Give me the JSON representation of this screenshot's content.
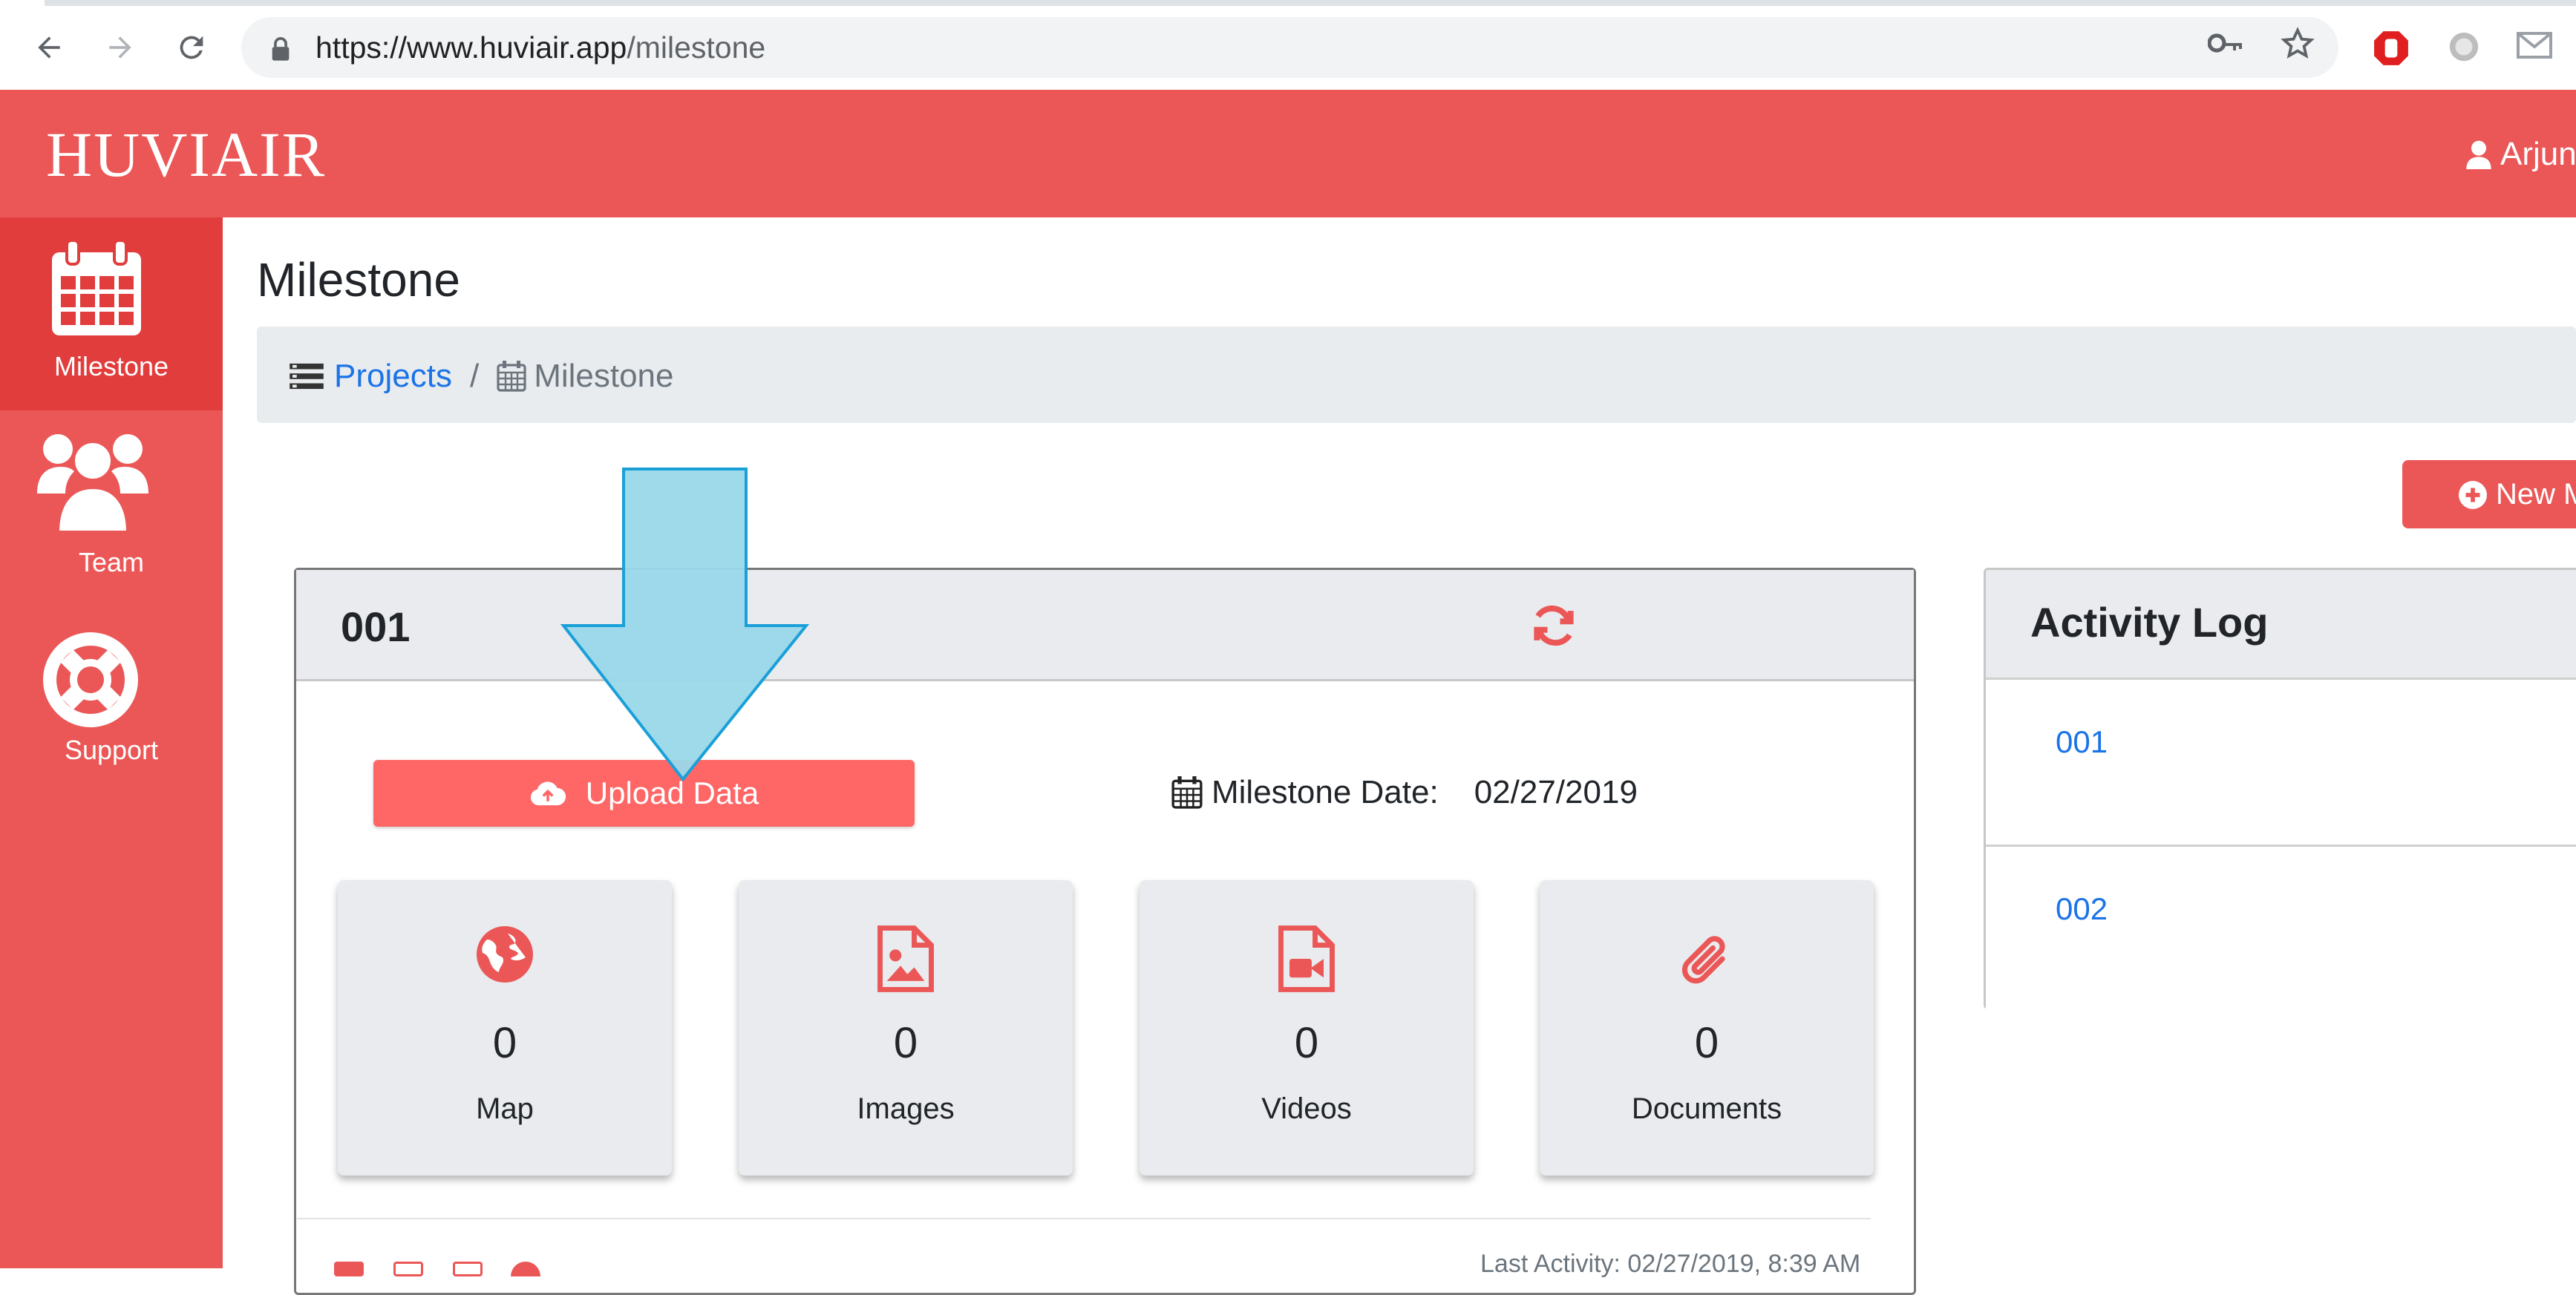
{
  "browser": {
    "url_host": "https://www.huviair.app",
    "url_path": "/milestone"
  },
  "app": {
    "logo": "HUVIAIR",
    "user_name": "Arjun"
  },
  "sidebar": {
    "items": [
      {
        "label": "Milestone",
        "icon": "calendar-icon",
        "active": true
      },
      {
        "label": "Team",
        "icon": "users-icon",
        "active": false
      },
      {
        "label": "Support",
        "icon": "life-ring-icon",
        "active": false
      }
    ]
  },
  "page": {
    "title": "Milestone",
    "breadcrumb": {
      "projects": "Projects",
      "separator": "/",
      "current": "Milestone"
    },
    "new_button": "New M"
  },
  "milestone_card": {
    "id": "001",
    "upload_label": "Upload Data",
    "date_label": "Milestone Date:",
    "date_value": "02/27/2019",
    "stats": [
      {
        "label": "Map",
        "count": "0",
        "icon": "globe-icon"
      },
      {
        "label": "Images",
        "count": "0",
        "icon": "file-image-icon"
      },
      {
        "label": "Videos",
        "count": "0",
        "icon": "file-video-icon"
      },
      {
        "label": "Documents",
        "count": "0",
        "icon": "paperclip-icon"
      }
    ],
    "last_activity": "Last Activity: 02/27/2019, 8:39 AM"
  },
  "activity_log": {
    "title": "Activity Log",
    "items": [
      "001",
      "002"
    ]
  },
  "colors": {
    "brand": "#eb5757",
    "brand_dark": "#e13d3d",
    "button": "#ff6767",
    "link": "#1b73e8",
    "arrow_fill": "#9ad8ea",
    "arrow_stroke": "#1aa0d8"
  }
}
